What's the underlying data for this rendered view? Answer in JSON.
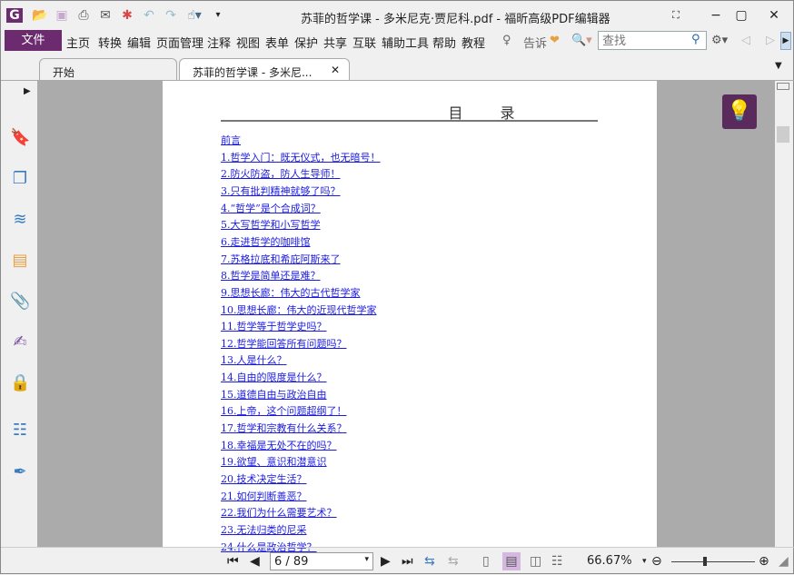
{
  "window": {
    "title": "苏菲的哲学课 - 多米尼克·贾尼科.pdf - 福昕高级PDF编辑器"
  },
  "menu": {
    "file": "文件",
    "items": [
      "主页",
      "转换",
      "编辑",
      "页面管理",
      "注释",
      "视图",
      "表单",
      "保护",
      "共享",
      "互联",
      "辅助工具",
      "帮助",
      "教程"
    ],
    "tell": "告诉",
    "search_placeholder": "查找"
  },
  "tabs": [
    {
      "label": "开始"
    },
    {
      "label": "苏菲的哲学课 - 多米尼..."
    }
  ],
  "document": {
    "toc_title": "目 录",
    "entries": [
      "前言",
      "1.哲学入门：既无仪式，也无暗号！",
      "2.防火防盗，防人生导师！",
      "3.只有批判精神就够了吗？",
      "4.“哲学”是个合成词？",
      "5.大写哲学和小写哲学",
      "6.走进哲学的咖啡馆",
      "7.苏格拉底和希庇阿斯来了",
      "8.哲学是简单还是难？",
      "9.思想长廊：伟大的古代哲学家",
      "10.思想长廊：伟大的近现代哲学家",
      "11.哲学等于哲学史吗？",
      "12.哲学能回答所有问题吗？",
      "13.人是什么？",
      "14.自由的限度是什么？",
      "15.道德自由与政治自由",
      "16.上帝，这个问题超纲了！",
      "17.哲学和宗教有什么关系？",
      "18.幸福是无处不在的吗？",
      "19.欲望、意识和潜意识",
      "20.技术决定生活？",
      "21.如何判断善恶？",
      "22.我们为什么需要艺术？",
      "23.无法归类的尼采",
      "24.什么是政治哲学？"
    ]
  },
  "status": {
    "page": "6 / 89",
    "zoom": "66.67%",
    "zoom_slider_percent": 40
  },
  "colors": {
    "accent": "#6b2b6e",
    "link": "#1a1ae0"
  }
}
